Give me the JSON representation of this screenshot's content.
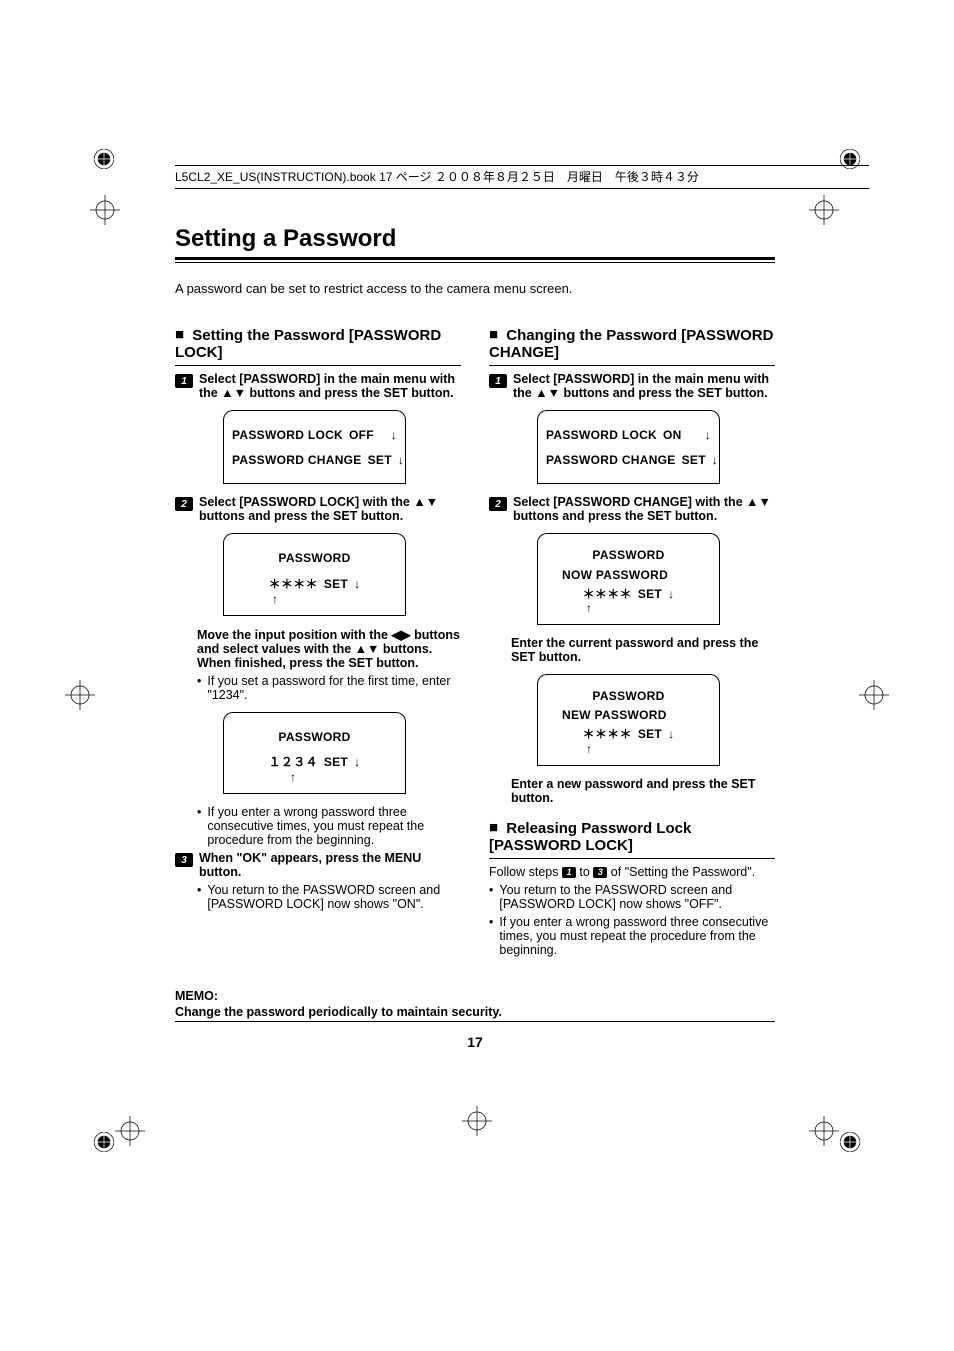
{
  "header": "L5CL2_XE_US(INSTRUCTION).book  17 ページ  ２００８年８月２５日　月曜日　午後３時４３分",
  "title": "Setting a Password",
  "intro": "A password can be set to restrict access to the camera menu screen.",
  "page_num": "17",
  "left": {
    "section": "Setting the Password [PASSWORD LOCK]",
    "step1": "Select [PASSWORD] in the main menu with the ▲▼ buttons and press the SET button.",
    "screen1": {
      "r1a": "PASSWORD LOCK",
      "r1b": "OFF",
      "r1c": "↓",
      "r2a": "PASSWORD CHANGE",
      "r2b": "SET",
      "r2c": "↓"
    },
    "step2": "Select [PASSWORD LOCK] with the ▲▼ buttons and press the SET button.",
    "screen2": {
      "h": "PASSWORD",
      "r1a": "＊＊＊＊",
      "r1b": "SET",
      "r1c": "↓",
      "r2": "↑"
    },
    "sub1": "Move the input position with the ◀▶ buttons and select values with the ▲▼ buttons. When finished, press the SET button.",
    "bullet1": "If you set a password for the first time, enter \"1234\".",
    "screen3": {
      "h": "PASSWORD",
      "r1a": "１２３４",
      "r1b": "SET",
      "r1c": "↓",
      "r2": "↑"
    },
    "bullet2": "If you enter a wrong password three consecutive times, you must repeat the procedure from the beginning.",
    "step3": "When \"OK\" appears, press the MENU button.",
    "bullet3": "You return to the PASSWORD screen and [PASSWORD LOCK] now shows \"ON\"."
  },
  "right": {
    "section1": "Changing the Password [PASSWORD CHANGE]",
    "step1": "Select [PASSWORD] in the main menu with the ▲▼ buttons and press the SET button.",
    "screen1": {
      "r1a": "PASSWORD LOCK",
      "r1b": "ON",
      "r1c": "↓",
      "r2a": "PASSWORD CHANGE",
      "r2b": "SET",
      "r2c": "↓"
    },
    "step2": "Select [PASSWORD CHANGE] with the ▲▼ buttons and press the SET button.",
    "screen2": {
      "h": "PASSWORD",
      "l": "NOW PASSWORD",
      "r1a": "＊＊＊＊",
      "r1b": "SET",
      "r1c": "↓",
      "r2": "↑"
    },
    "sub1": "Enter the current password and press the SET button.",
    "screen3": {
      "h": "PASSWORD",
      "l": "NEW PASSWORD",
      "r1a": "＊＊＊＊",
      "r1b": "SET",
      "r1c": "↓",
      "r2": "↑"
    },
    "sub2": "Enter a new password and press the SET button.",
    "section2": "Releasing Password Lock [PASSWORD LOCK]",
    "follow": "Follow steps ",
    "follow_mid": " to ",
    "follow_end": " of \"Setting the Password\".",
    "bulletA": "You return to the PASSWORD screen and [PASSWORD LOCK] now shows \"OFF\".",
    "bulletB": "If you enter a wrong password three consecutive times, you must repeat the procedure from the beginning."
  },
  "memo": {
    "title": "MEMO:",
    "text": "Change the password periodically to maintain security."
  }
}
